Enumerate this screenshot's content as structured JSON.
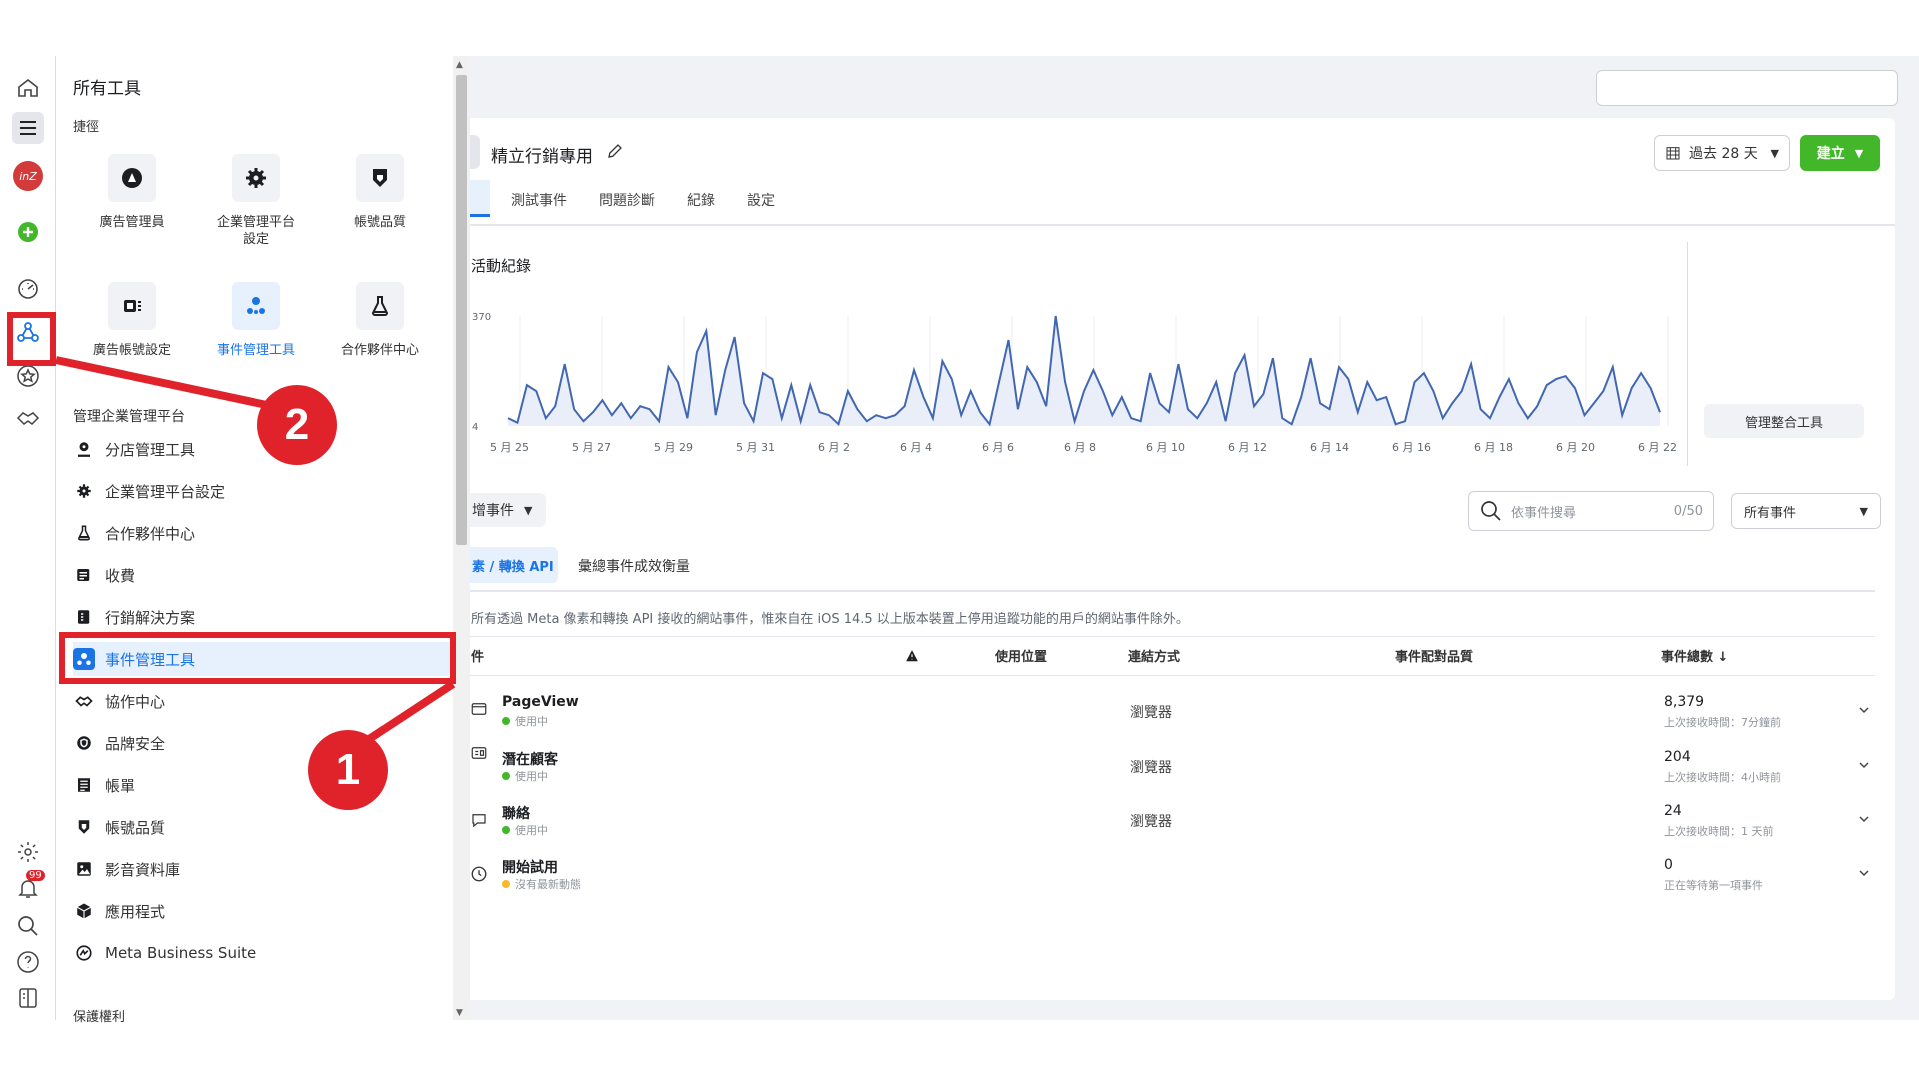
{
  "panel": {
    "title": "所有工具",
    "shortcuts_heading": "捷徑",
    "tiles": [
      {
        "label": "廣告管理員",
        "icon": "ads-manager-icon"
      },
      {
        "label": "企業管理平台設定",
        "icon": "gear-icon"
      },
      {
        "label": "帳號品質",
        "icon": "shield-icon"
      },
      {
        "label": "廣告帳號設定",
        "icon": "ad-account-icon"
      },
      {
        "label": "事件管理工具",
        "icon": "events-manager-icon"
      },
      {
        "label": "合作夥伴中心",
        "icon": "flask-icon"
      }
    ],
    "section_heading": "管理企業管理平台",
    "menu": [
      {
        "label": "分店管理工具",
        "icon": "store-locator-icon"
      },
      {
        "label": "企業管理平台設定",
        "icon": "gear-icon"
      },
      {
        "label": "合作夥伴中心",
        "icon": "flask-icon"
      },
      {
        "label": "收費",
        "icon": "billing-icon"
      },
      {
        "label": "行銷解決方案",
        "icon": "solutions-icon"
      },
      {
        "label": "事件管理工具",
        "icon": "events-manager-icon"
      },
      {
        "label": "協作中心",
        "icon": "handshake-icon"
      },
      {
        "label": "品牌安全",
        "icon": "shield-icon"
      },
      {
        "label": "帳單",
        "icon": "invoice-icon"
      },
      {
        "label": "帳號品質",
        "icon": "shield-icon"
      },
      {
        "label": "影音資料庫",
        "icon": "media-library-icon"
      },
      {
        "label": "應用程式",
        "icon": "cube-icon"
      },
      {
        "label": "Meta Business Suite",
        "icon": "meta-suite-icon"
      }
    ],
    "footer_heading": "保護權利"
  },
  "rail": {
    "notification_badge": "99",
    "avatar_text": "inZ"
  },
  "main": {
    "pixel_name": "精立行銷專用",
    "tabs": [
      "測試事件",
      "問題診斷",
      "紀錄",
      "設定"
    ],
    "date_button": "過去 28 天",
    "create_button": "建立",
    "activity_title": "活動紀錄",
    "manage_integrations": "管理整合工具",
    "add_events": "增事件",
    "search_placeholder": "依事件搜尋",
    "search_count": "0/50",
    "filter_select": "所有事件",
    "subtabs": [
      "素 / 轉換 API",
      "彙總事件成效衡量"
    ],
    "notice": "所有透過 Meta 像素和轉換 API 接收的網站事件，惟來自在 iOS 14.5 以上版本裝置上停用追蹤功能的用戶的網站事件除外。",
    "columns": [
      "件",
      "使用位置",
      "連結方式",
      "事件配對品質",
      "事件總數 ↓"
    ],
    "events": [
      {
        "name": "PageView",
        "status": "使用中",
        "status_color": "#42b72a",
        "connection": "瀏覽器",
        "count": "8,379",
        "last": "上次接收時間：7分鐘前"
      },
      {
        "name": "潛在顧客",
        "status": "使用中",
        "status_color": "#42b72a",
        "connection": "瀏覽器",
        "count": "204",
        "last": "上次接收時間：4小時前"
      },
      {
        "name": "聯絡",
        "status": "使用中",
        "status_color": "#42b72a",
        "connection": "瀏覽器",
        "count": "24",
        "last": "上次接收時間：1 天前"
      },
      {
        "name": "開始試用",
        "status": "沒有最新動態",
        "status_color": "#f7b928",
        "connection": "",
        "count": "0",
        "last": "正在等待第一項事件"
      }
    ]
  },
  "callouts": {
    "one": "1",
    "two": "2"
  },
  "colors": {
    "accent": "#1b74e4",
    "callout": "#e0222a",
    "create": "#42b72a",
    "line": "#4267b2"
  },
  "chart_data": {
    "type": "line",
    "title": "活動紀錄",
    "xlabel": "",
    "ylabel": "",
    "ylim": [
      4,
      370
    ],
    "ytick_labels": [
      "370",
      "4"
    ],
    "xtick_labels": [
      "5 月 25",
      "5 月 27",
      "5 月 29",
      "5 月 31",
      "6 月 2",
      "6 月 4",
      "6 月 6",
      "6 月 8",
      "6 月 10",
      "6 月 12",
      "6 月 14",
      "6 月 16",
      "6 月 18",
      "6 月 20",
      "6 月 22"
    ],
    "values": [
      30,
      15,
      140,
      120,
      30,
      70,
      210,
      60,
      20,
      50,
      90,
      40,
      80,
      30,
      70,
      60,
      20,
      200,
      150,
      30,
      250,
      320,
      40,
      190,
      300,
      80,
      20,
      180,
      160,
      30,
      140,
      20,
      140,
      50,
      40,
      10,
      120,
      60,
      20,
      40,
      30,
      40,
      70,
      190,
      100,
      30,
      220,
      160,
      40,
      120,
      50,
      10,
      150,
      290,
      60,
      200,
      150,
      70,
      370,
      150,
      20,
      120,
      190,
      120,
      40,
      100,
      30,
      20,
      180,
      80,
      50,
      210,
      60,
      30,
      80,
      150,
      20,
      180,
      240,
      70,
      110,
      230,
      30,
      10,
      100,
      230,
      80,
      60,
      200,
      160,
      50,
      150,
      90,
      100,
      10,
      20,
      150,
      180,
      120,
      30,
      80,
      120,
      210,
      60,
      30,
      100,
      160,
      80,
      30,
      70,
      140,
      160,
      170,
      130,
      40,
      80,
      120,
      200,
      40,
      130,
      180,
      130,
      50
    ]
  }
}
